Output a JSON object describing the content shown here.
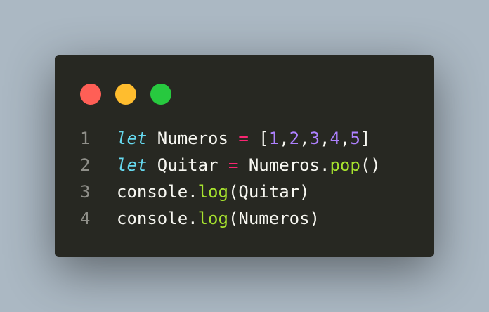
{
  "theme": {
    "background": "#abb8c3",
    "editor_background": "#272822",
    "dot_colors": [
      "#ff5f56",
      "#ffbd2e",
      "#27c93f"
    ]
  },
  "window_controls": [
    {
      "name": "close",
      "color": "#ff5f56"
    },
    {
      "name": "minimize",
      "color": "#ffbd2e"
    },
    {
      "name": "maximize",
      "color": "#27c93f"
    }
  ],
  "code": {
    "language": "javascript",
    "lines": [
      {
        "number": "1",
        "tokens": [
          {
            "text": "let",
            "type": "kw"
          },
          {
            "text": " Numeros ",
            "type": "pl"
          },
          {
            "text": "=",
            "type": "op"
          },
          {
            "text": " [",
            "type": "pl"
          },
          {
            "text": "1",
            "type": "num"
          },
          {
            "text": ",",
            "type": "pl"
          },
          {
            "text": "2",
            "type": "num"
          },
          {
            "text": ",",
            "type": "pl"
          },
          {
            "text": "3",
            "type": "num"
          },
          {
            "text": ",",
            "type": "pl"
          },
          {
            "text": "4",
            "type": "num"
          },
          {
            "text": ",",
            "type": "pl"
          },
          {
            "text": "5",
            "type": "num"
          },
          {
            "text": "]",
            "type": "pl"
          }
        ]
      },
      {
        "number": "2",
        "tokens": [
          {
            "text": "let",
            "type": "kw"
          },
          {
            "text": " Quitar ",
            "type": "pl"
          },
          {
            "text": "=",
            "type": "op"
          },
          {
            "text": " Numeros.",
            "type": "pl"
          },
          {
            "text": "pop",
            "type": "fn"
          },
          {
            "text": "()",
            "type": "pl"
          }
        ]
      },
      {
        "number": "3",
        "tokens": [
          {
            "text": "console.",
            "type": "pl"
          },
          {
            "text": "log",
            "type": "fn"
          },
          {
            "text": "(Quitar)",
            "type": "pl"
          }
        ]
      },
      {
        "number": "4",
        "tokens": [
          {
            "text": "console.",
            "type": "pl"
          },
          {
            "text": "log",
            "type": "fn"
          },
          {
            "text": "(Numeros)",
            "type": "pl"
          }
        ]
      }
    ]
  }
}
